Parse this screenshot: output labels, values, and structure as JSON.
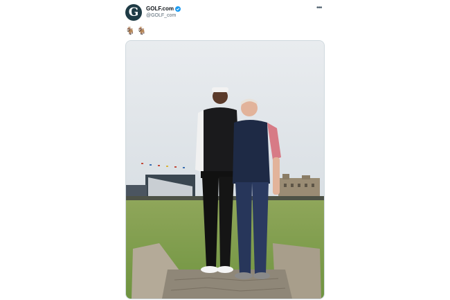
{
  "account": {
    "display_name": "GOLF.com",
    "handle": "@GOLF_com",
    "avatar_letter": "G"
  },
  "more_label": "•••",
  "tweet": {
    "emojis": [
      "🐐",
      "🐐"
    ]
  }
}
